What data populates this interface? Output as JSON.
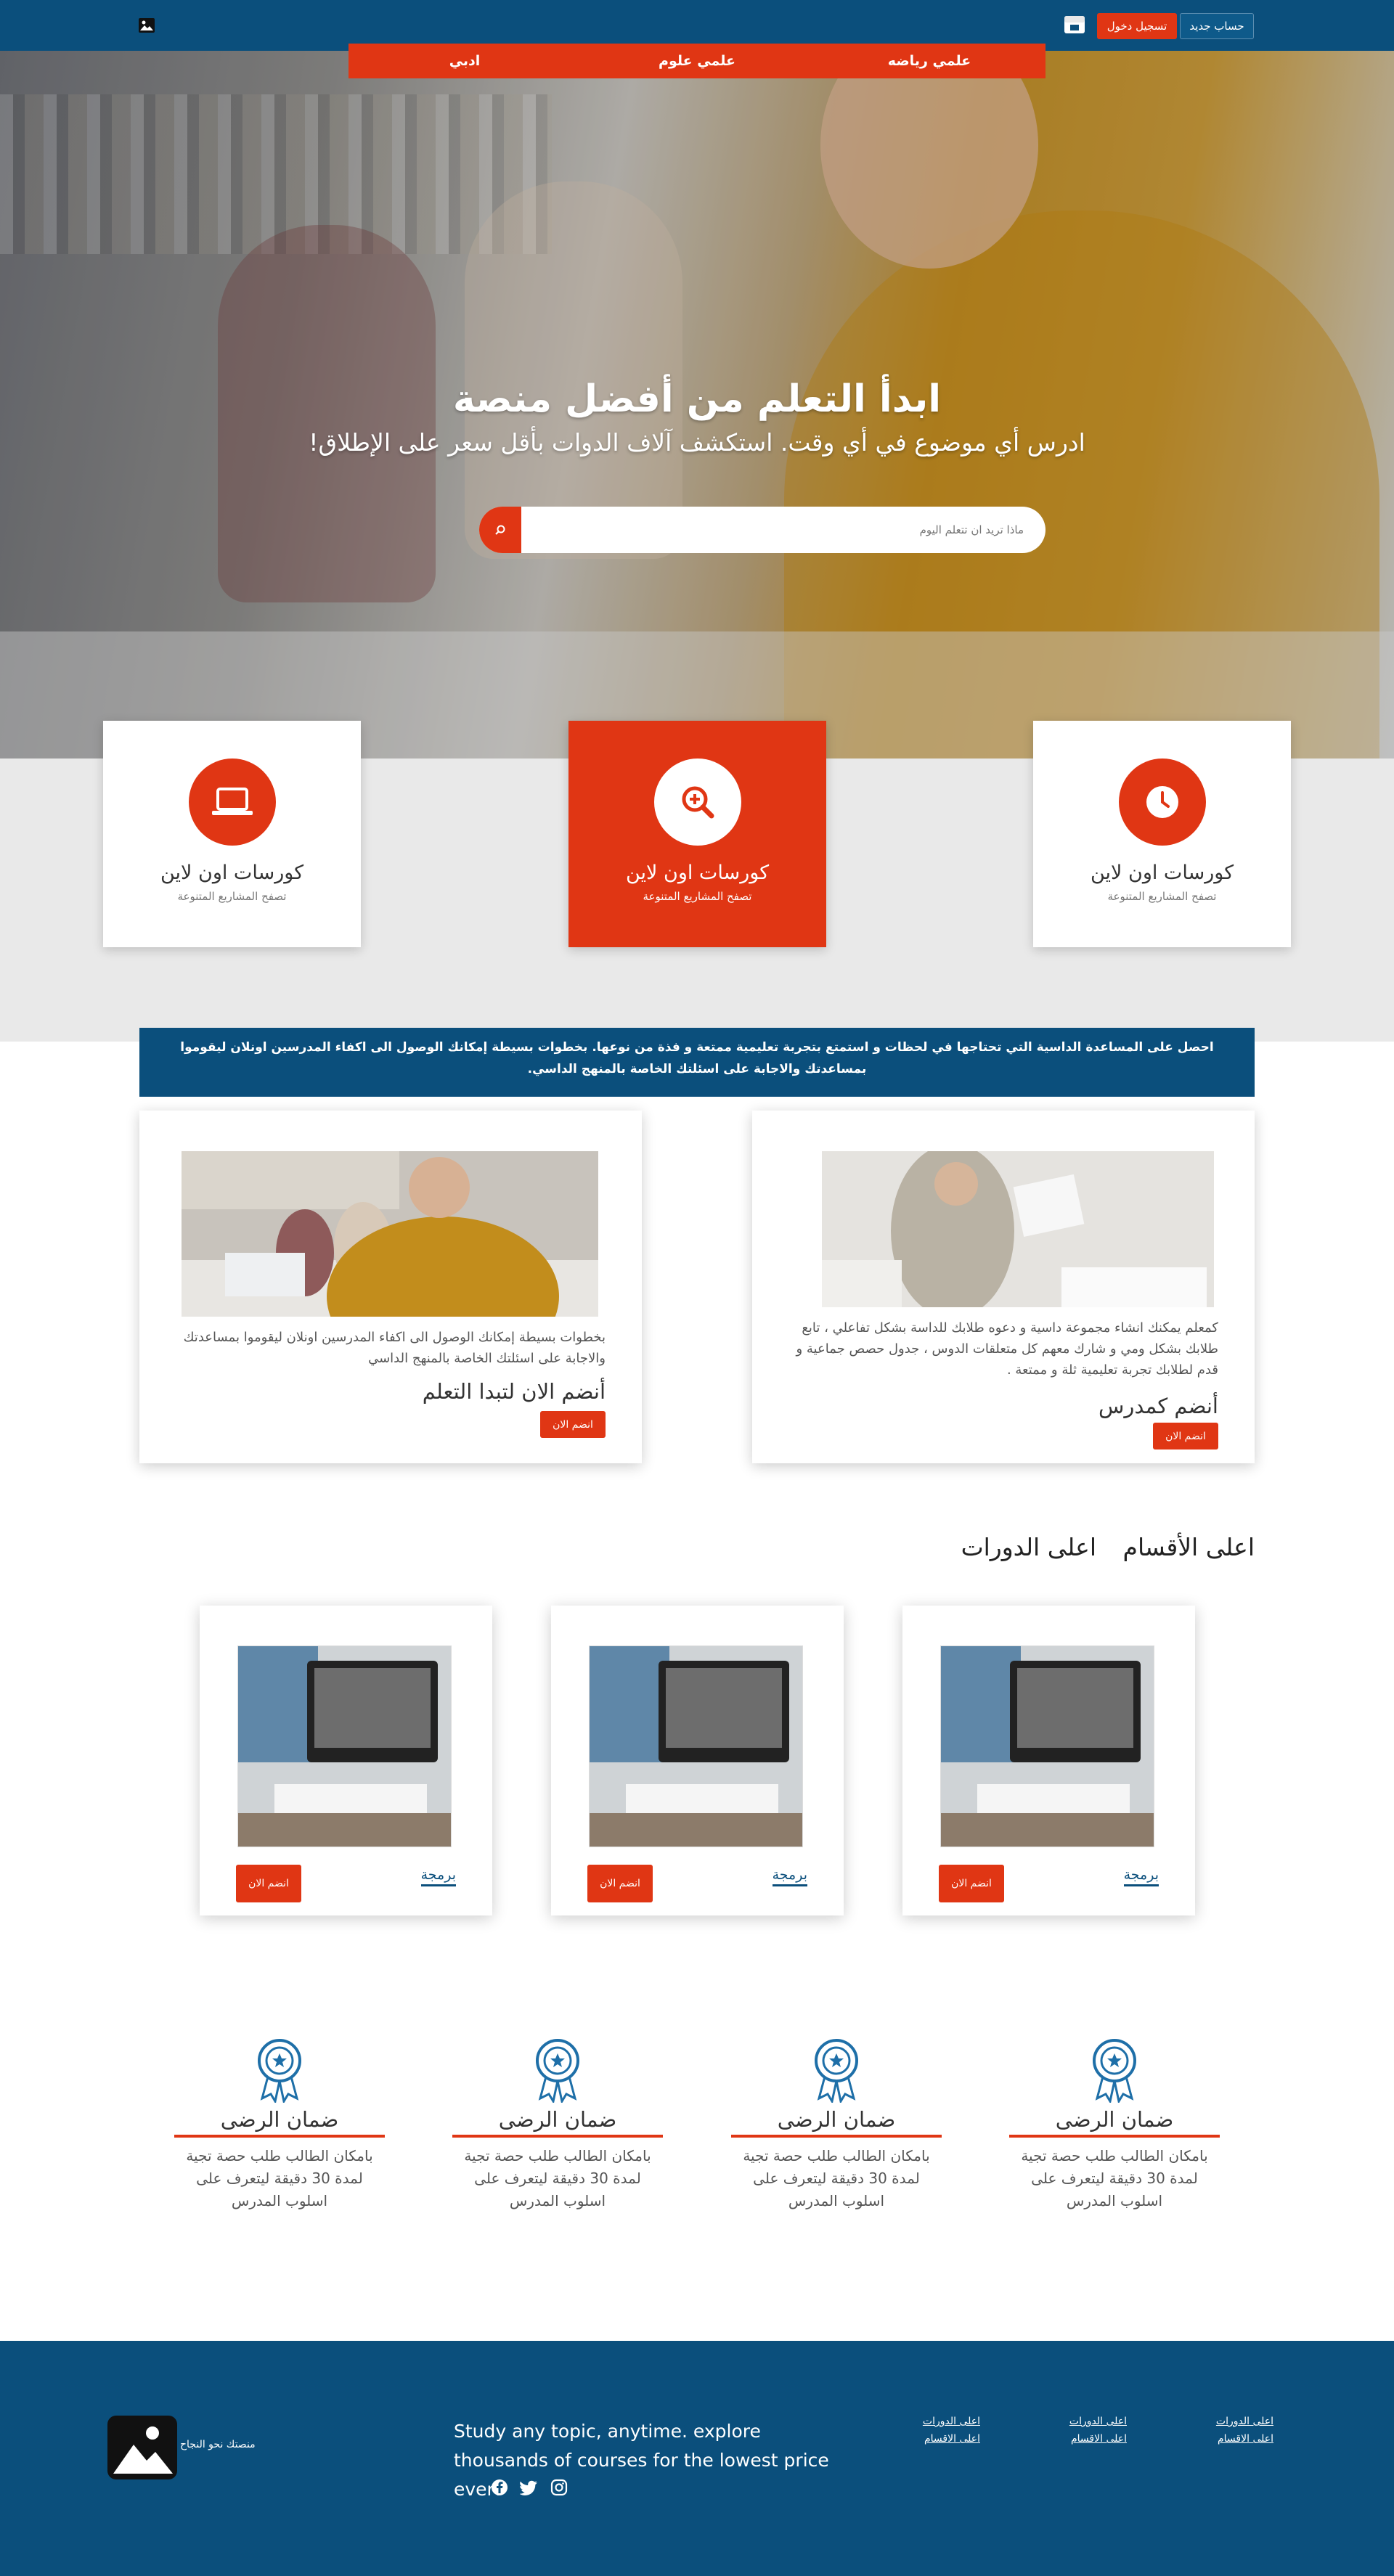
{
  "header": {
    "new_account": "حساب جديد",
    "login": "تسجيل دخول"
  },
  "nav": {
    "items": [
      "علمي رياضه",
      "علمي علوم",
      "ادبي"
    ]
  },
  "hero": {
    "title": "ابدأ التعلم من أفضل منصة",
    "subtitle": "ادرس أي موضوع في أي وقت. استكشف آلاف الدوات بأقل سعر على الإطلاق!",
    "search_placeholder": "ماذا تريد ان تتعلم اليوم"
  },
  "features": [
    {
      "title": "كورسات اون لاين",
      "subtitle": "تصفح المشاريع المتنوعة",
      "icon": "clock-icon"
    },
    {
      "title": "كورسات اون لاين",
      "subtitle": "تصفح المشاريع المتنوعة",
      "icon": "search-plus-icon"
    },
    {
      "title": "كورسات اون لاين",
      "subtitle": "تصفح المشاريع المتنوعة",
      "icon": "laptop-icon"
    }
  ],
  "info_bar": {
    "text": "احصل على المساعدة الداسية التي تحتاجها في لحظات و استمتع بتجربة تعليمية ممتعة و فذة من نوعها. بخطوات بسيطة إمكانك الوصول الى اكفاء المدرسين اونلان ليقوموا بمساعدتك والاجابة على اسئلتك الخاصة بالمنهج الداسي."
  },
  "join": {
    "teacher": {
      "text": "كمعلم يمكنك انشاء مجموعة داسية و دعوه طلابك للداسة بشكل تفاعلي ، تابع طلابك بشكل ومي و شارك معهم كل متعلقات الدوس ، جدول حصص جماعية و قدم لطلابك تجربة تعليمية ثلة و ممتعة .",
      "title": "أنضم كمدرس",
      "button": "انضم الان"
    },
    "student": {
      "text": "بخطوات بسيطة إمكانك الوصول الى اكفاء المدرسين اونلان ليقوموا بمساعدتك والاجابة على اسئلتك الخاصة بالمنهج الداسي",
      "title": "أنضم الان لتبدا التعلم",
      "button": "انضم الان"
    }
  },
  "tabs": {
    "sections": "اعلى الأقسام",
    "courses": "اعلى الدورات"
  },
  "courses": [
    {
      "category": "برمجة",
      "button": "انضم الان"
    },
    {
      "category": "برمجة",
      "button": "انضم الان"
    },
    {
      "category": "برمجة",
      "button": "انضم الان"
    }
  ],
  "guarantees": [
    {
      "title": "ضمان الرضى",
      "desc": "بامكان الطالب طلب حصة تجية لمدة 30 دقيقة ليتعرف على اسلوب المدرس"
    },
    {
      "title": "ضمان الرضى",
      "desc": "بامكان الطالب طلب حصة تجية لمدة 30 دقيقة ليتعرف على اسلوب المدرس"
    },
    {
      "title": "ضمان الرضى",
      "desc": "بامكان الطالب طلب حصة تجية لمدة 30 دقيقة ليتعرف على اسلوب المدرس"
    },
    {
      "title": "ضمان الرضى",
      "desc": "بامكان الطالب طلب حصة تجية لمدة 30 دقيقة ليتعرف على اسلوب المدرس"
    }
  ],
  "footer": {
    "logo_text": "منصتك نحو النجاح",
    "tagline": "Study any topic, anytime. explore thousands of courses for the lowest price ever!",
    "link_columns": [
      [
        "اعلى الدورات",
        "اعلى الاقسام"
      ],
      [
        "اعلى الدورات",
        "اعلى الاقسام"
      ],
      [
        "اعلى الدورات",
        "اعلى الاقسام"
      ]
    ]
  },
  "colors": {
    "primary_blue": "#0b4f7c",
    "accent_orange": "#e03614"
  }
}
